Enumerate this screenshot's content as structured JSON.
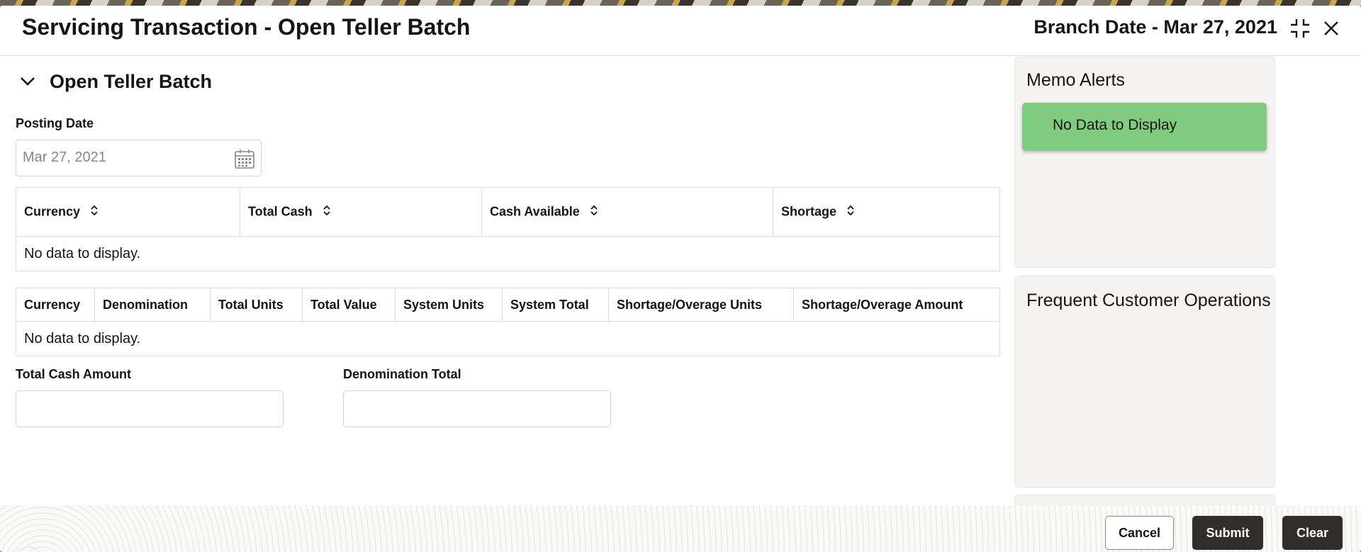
{
  "header": {
    "title": "Servicing Transaction - Open Teller Batch",
    "branch_date": "Branch Date - Mar 27, 2021",
    "collapse_icon": "collapse-icon",
    "close_icon": "close-icon"
  },
  "section": {
    "title": "Open Teller Batch"
  },
  "form": {
    "posting_date_label": "Posting Date",
    "posting_date_value": "Mar 27, 2021",
    "total_cash_amount_label": "Total Cash Amount",
    "total_cash_amount_value": "",
    "denomination_total_label": "Denomination Total",
    "denomination_total_value": ""
  },
  "table1": {
    "columns": [
      "Currency",
      "Total Cash",
      "Cash Available",
      "Shortage"
    ],
    "empty_text": "No data to display."
  },
  "table2": {
    "columns": [
      "Currency",
      "Denomination",
      "Total Units",
      "Total Value",
      "System Units",
      "System Total",
      "Shortage/Overage Units",
      "Shortage/Overage Amount"
    ],
    "empty_text": "No data to display."
  },
  "right_panel": {
    "memo_alerts_title": "Memo Alerts",
    "memo_alerts_empty": "No Data to Display",
    "frequent_ops_title": "Frequent Customer Operations"
  },
  "footer": {
    "cancel_label": "Cancel",
    "submit_label": "Submit",
    "clear_label": "Clear"
  },
  "colors": {
    "primary_button": "#312d2a",
    "memo_alert_bg": "#7fcb7f",
    "panel_bg": "#f5f4f2"
  }
}
